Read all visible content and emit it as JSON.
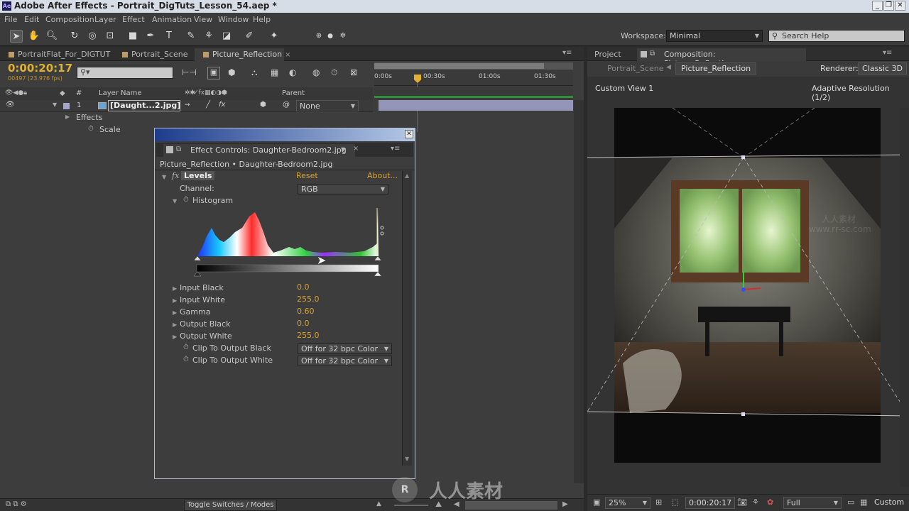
{
  "app": {
    "title": "Adobe After Effects - Portrait_DigTuts_Lesson_54.aep *",
    "logo": "Ae",
    "menu": [
      "File",
      "Edit",
      "Composition",
      "Layer",
      "Effect",
      "Animation",
      "View",
      "Window",
      "Help"
    ],
    "watermark_url": "www.rr-sc.com",
    "watermark_brand": "人人素材",
    "colors": {
      "timecode": "#e0b130",
      "value": "#d9a02c",
      "accent_blue": "#1d3c8c"
    }
  },
  "toolbar": {
    "workspace_label": "Workspace:",
    "workspace_value": "Minimal",
    "search_placeholder": "Search Help"
  },
  "timeline": {
    "tabs": [
      "PortraitFlat_For_DIGTUT",
      "Portrait_Scene",
      "Picture_Reflection"
    ],
    "active_tab": "Picture_Reflection",
    "timecode": "0:00:20:17",
    "fps": "00497 (23.976 fps)",
    "ruler": [
      "0:00s",
      "00:30s",
      "01:00s",
      "01:30s"
    ],
    "headers": {
      "num": "#",
      "layer_name": "Layer Name",
      "parent": "Parent"
    },
    "layer": {
      "index": "1",
      "name": "[Daught...2.jpg]",
      "parent": "None"
    },
    "sub_effects": "Effects",
    "sub_scale": "Scale",
    "toggle_label": "Toggle Switches / Modes"
  },
  "effect_controls": {
    "tab_title": "Effect Controls: Daughter-Bedroom2.jpg",
    "breadcrumb": "Picture_Reflection • Daughter-Bedroom2.jpg",
    "effect_name": "Levels",
    "reset": "Reset",
    "about": "About...",
    "channel_label": "Channel:",
    "channel_value": "RGB",
    "histogram_label": "Histogram",
    "params": [
      {
        "label": "Input Black",
        "value": "0.0"
      },
      {
        "label": "Input White",
        "value": "255.0"
      },
      {
        "label": "Gamma",
        "value": "0.60"
      },
      {
        "label": "Output Black",
        "value": "0.0"
      },
      {
        "label": "Output White",
        "value": "255.0"
      }
    ],
    "clips": [
      {
        "label": "Clip To Output Black",
        "value": "Off for 32 bpc Color"
      },
      {
        "label": "Clip To Output White",
        "value": "Off for 32 bpc Color"
      }
    ]
  },
  "composition": {
    "tabs": [
      "Project",
      "Composition: Picture_Reflection"
    ],
    "breadcrumbs": [
      "Portrait_Scene",
      "Picture_Reflection"
    ],
    "renderer_label": "Renderer:",
    "renderer_value": "Classic 3D",
    "view_label": "Custom View 1",
    "resolution_label": "Adaptive Resolution (1/2)",
    "zoom": "25%",
    "timecode": "0:00:20:17",
    "quality": "Full",
    "view_mode": "Custom"
  }
}
